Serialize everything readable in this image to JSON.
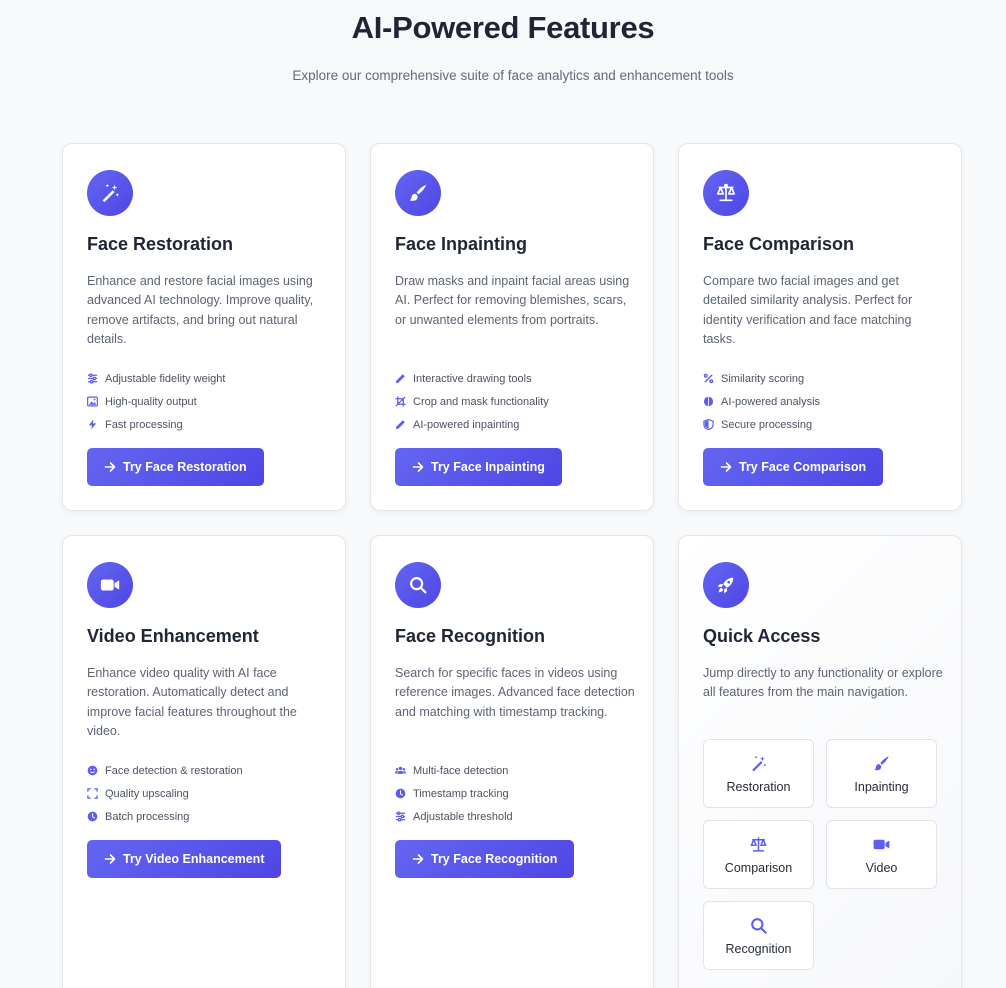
{
  "header": {
    "title": "AI-Powered Features",
    "subtitle": "Explore our comprehensive suite of face analytics and enhancement tools"
  },
  "colors": {
    "accent": "#5b5ef0",
    "accent_dark": "#4f46e5",
    "text_dark": "#1f2535",
    "text_muted": "#5c6473"
  },
  "cards": [
    {
      "icon": "magic-wand-icon",
      "title": "Face Restoration",
      "description": "Enhance and restore facial images using advanced AI technology. Improve quality, remove artifacts, and bring out natural details.",
      "features": [
        {
          "icon": "sliders-icon",
          "label": "Adjustable fidelity weight"
        },
        {
          "icon": "image-icon",
          "label": "High-quality output"
        },
        {
          "icon": "bolt-icon",
          "label": "Fast processing"
        }
      ],
      "button": "Try Face Restoration"
    },
    {
      "icon": "paintbrush-icon",
      "title": "Face Inpainting",
      "description": "Draw masks and inpaint facial areas using AI. Perfect for removing blemishes, scars, or unwanted elements from portraits.",
      "features": [
        {
          "icon": "pencil-icon",
          "label": "Interactive drawing tools"
        },
        {
          "icon": "crop-icon",
          "label": "Crop and mask functionality"
        },
        {
          "icon": "pencil-icon",
          "label": "AI-powered inpainting"
        }
      ],
      "button": "Try Face Inpainting"
    },
    {
      "icon": "balance-scale-icon",
      "title": "Face Comparison",
      "description": "Compare two facial images and get detailed similarity analysis. Perfect for identity verification and face matching tasks.",
      "features": [
        {
          "icon": "percent-icon",
          "label": "Similarity scoring"
        },
        {
          "icon": "brain-icon",
          "label": "AI-powered analysis"
        },
        {
          "icon": "shield-icon",
          "label": "Secure processing"
        }
      ],
      "button": "Try Face Comparison"
    },
    {
      "icon": "video-camera-icon",
      "title": "Video Enhancement",
      "description": "Enhance video quality with AI face restoration. Automatically detect and improve facial features throughout the video.",
      "features": [
        {
          "icon": "smile-icon",
          "label": "Face detection & restoration"
        },
        {
          "icon": "expand-icon",
          "label": "Quality upscaling"
        },
        {
          "icon": "clock-icon",
          "label": "Batch processing"
        }
      ],
      "button": "Try Video Enhancement"
    },
    {
      "icon": "search-icon",
      "title": "Face Recognition",
      "description": "Search for specific faces in videos using reference images. Advanced face detection and matching with timestamp tracking.",
      "features": [
        {
          "icon": "users-icon",
          "label": "Multi-face detection"
        },
        {
          "icon": "clock-icon",
          "label": "Timestamp tracking"
        },
        {
          "icon": "sliders-icon",
          "label": "Adjustable threshold"
        }
      ],
      "button": "Try Face Recognition"
    }
  ],
  "quick_access": {
    "icon": "rocket-icon",
    "title": "Quick Access",
    "description": "Jump directly to any functionality or explore all features from the main navigation.",
    "links": [
      {
        "icon": "magic-wand-icon",
        "label": "Restoration"
      },
      {
        "icon": "paintbrush-icon",
        "label": "Inpainting"
      },
      {
        "icon": "balance-scale-icon",
        "label": "Comparison"
      },
      {
        "icon": "video-camera-icon",
        "label": "Video"
      },
      {
        "icon": "search-icon",
        "label": "Recognition"
      }
    ]
  }
}
